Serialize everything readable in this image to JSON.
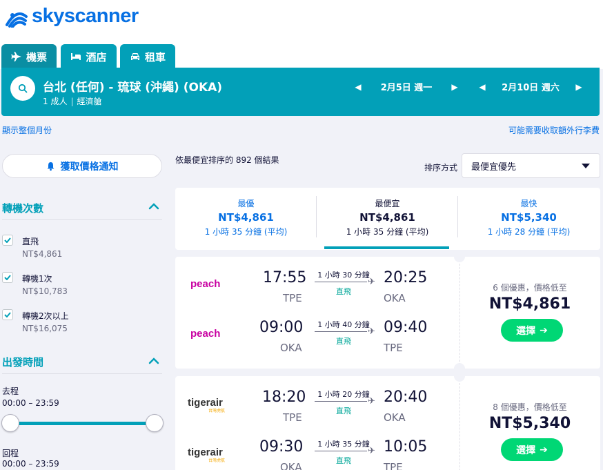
{
  "brand": {
    "name": "skyscanner",
    "color": "#0770e3"
  },
  "tabs": [
    {
      "label": "機票",
      "icon": "plane-icon",
      "active": true
    },
    {
      "label": "酒店",
      "icon": "bed-icon",
      "active": false
    },
    {
      "label": "租車",
      "icon": "car-icon",
      "active": false
    }
  ],
  "search": {
    "route": "台北 (任何) - 琉球 (沖繩) (OKA)",
    "passengers": "1 成人",
    "cabin": "經濟艙",
    "depart_date": "2月5日 週一",
    "return_date": "2月10日 週六"
  },
  "links": {
    "show_month": "顯示整個月份",
    "extra_fees": "可能需要收取額外行李費"
  },
  "alert_button": "獲取價格通知",
  "filters": {
    "stops_title": "轉機次數",
    "stops": [
      {
        "label": "直飛",
        "price": "NT$4,861",
        "checked": true
      },
      {
        "label": "轉機1次",
        "price": "NT$10,783",
        "checked": true
      },
      {
        "label": "轉機2次以上",
        "price": "NT$16,075",
        "checked": true
      }
    ],
    "times_title": "出發時間",
    "outbound_label": "去程",
    "outbound_range": "00:00 – 23:59",
    "return_label": "回程",
    "return_range": "00:00 – 23:59"
  },
  "results": {
    "count_text": "依最便宜排序的 892 個結果",
    "sort_label": "排序方式",
    "sort_value": "最便宜優先"
  },
  "sort_tabs": [
    {
      "title": "最優",
      "price": "NT$4,861",
      "duration": "1 小時 35 分鐘 (平均)",
      "active": false
    },
    {
      "title": "最便宜",
      "price": "NT$4,861",
      "duration": "1 小時 35 分鐘 (平均)",
      "active": true
    },
    {
      "title": "最快",
      "price": "NT$5,340",
      "duration": "1 小時 28 分鐘 (平均)",
      "active": false
    }
  ],
  "flights": [
    {
      "airline": "peach",
      "legs": [
        {
          "dep": "17:55",
          "dep_code": "TPE",
          "arr": "20:25",
          "arr_code": "OKA",
          "duration": "1 小時 30 分鐘",
          "stops": "直飛"
        },
        {
          "dep": "09:00",
          "dep_code": "OKA",
          "arr": "09:40",
          "arr_code": "TPE",
          "duration": "1 小時 40 分鐘",
          "stops": "直飛"
        }
      ],
      "deals": "6 個優惠，價格低至",
      "price": "NT$4,861",
      "select": "選擇"
    },
    {
      "airline": "tigerair",
      "airline_sub": "台灣虎航",
      "legs": [
        {
          "dep": "18:20",
          "dep_code": "TPE",
          "arr": "20:40",
          "arr_code": "OKA",
          "duration": "1 小時 20 分鐘",
          "stops": "直飛"
        },
        {
          "dep": "09:30",
          "dep_code": "OKA",
          "arr": "10:05",
          "arr_code": "TPE",
          "duration": "1 小時 35 分鐘",
          "stops": "直飛"
        }
      ],
      "deals": "8 個優惠，價格低至",
      "price": "NT$5,340",
      "select": "選擇"
    }
  ],
  "colors": {
    "teal": "#02a0b8",
    "link": "#0770e3",
    "select_green": "#00d775",
    "direct_green": "#00a698",
    "peach": "#c800a1",
    "tigerair": "#f5a800"
  }
}
